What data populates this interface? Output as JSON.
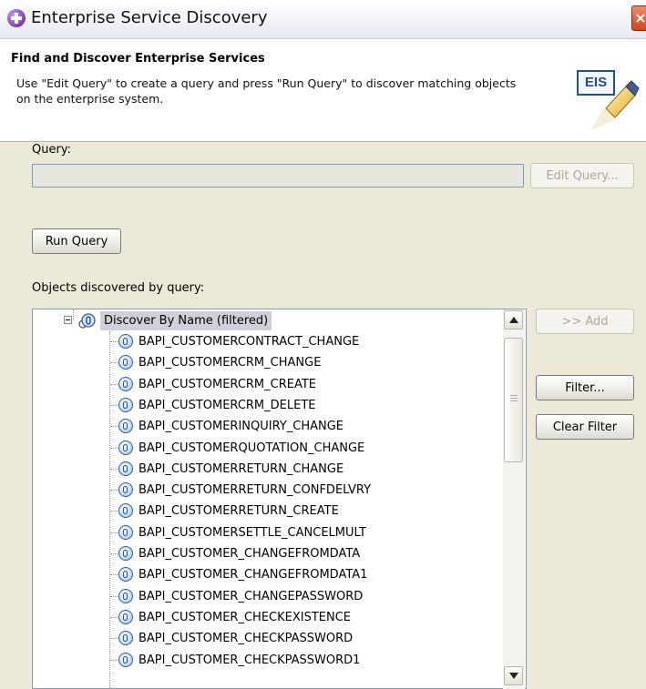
{
  "window": {
    "title": "Enterprise Service Discovery",
    "close_label": "×",
    "app_icon": "plus-circle-icon"
  },
  "header": {
    "title": "Find and Discover Enterprise Services",
    "description": "Use \"Edit Query\" to create a query and press \"Run Query\" to discover matching objects on the enterprise system.",
    "logo_text": "EIS"
  },
  "query": {
    "label": "Query:",
    "value": "",
    "edit_button": "Edit Query...",
    "run_button": "Run Query"
  },
  "objects": {
    "label": "Objects discovered by query:",
    "root": "Discover By Name (filtered)",
    "items": [
      "BAPI_CUSTOMERCONTRACT_CHANGE",
      "BAPI_CUSTOMERCRM_CHANGE",
      "BAPI_CUSTOMERCRM_CREATE",
      "BAPI_CUSTOMERCRM_DELETE",
      "BAPI_CUSTOMERINQUIRY_CHANGE",
      "BAPI_CUSTOMERQUOTATION_CHANGE",
      "BAPI_CUSTOMERRETURN_CHANGE",
      "BAPI_CUSTOMERRETURN_CONFDELVRY",
      "BAPI_CUSTOMERRETURN_CREATE",
      "BAPI_CUSTOMERSETTLE_CANCELMULT",
      "BAPI_CUSTOMER_CHANGEFROMDATA",
      "BAPI_CUSTOMER_CHANGEFROMDATA1",
      "BAPI_CUSTOMER_CHANGEPASSWORD",
      "BAPI_CUSTOMER_CHECKEXISTENCE",
      "BAPI_CUSTOMER_CHECKPASSWORD",
      "BAPI_CUSTOMER_CHECKPASSWORD1"
    ]
  },
  "side_buttons": {
    "add": ">> Add",
    "filter": "Filter...",
    "clear_filter": "Clear Filter"
  }
}
